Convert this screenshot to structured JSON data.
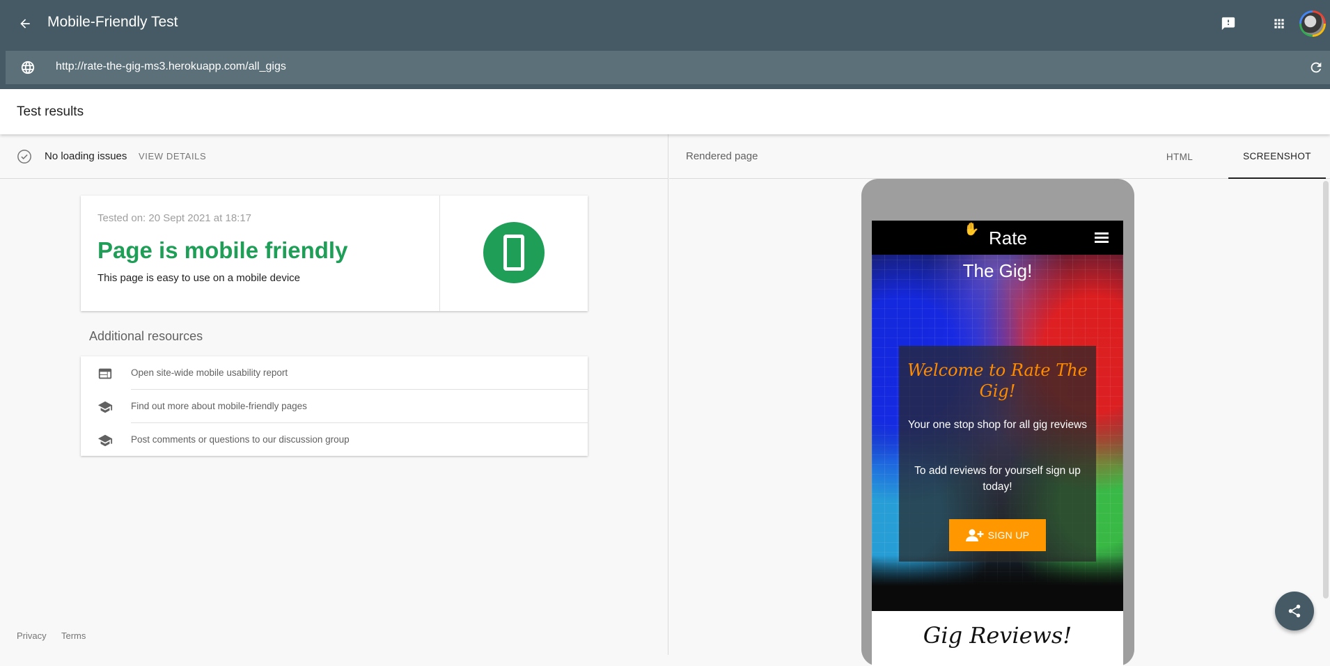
{
  "app": {
    "title": "Mobile-Friendly Test",
    "url": "http://rate-the-gig-ms3.herokuapp.com/all_gigs"
  },
  "results": {
    "title": "Test results"
  },
  "status": {
    "text": "No loading issues",
    "view_details": "VIEW DETAILS"
  },
  "card": {
    "tested_on": "Tested on: 20 Sept 2021 at 18:17",
    "verdict": "Page is mobile friendly",
    "subtitle": "This page is easy to use on a mobile device"
  },
  "resources": {
    "title": "Additional resources",
    "items": [
      {
        "label": "Open site-wide mobile usability report",
        "icon": "web-icon"
      },
      {
        "label": "Find out more about mobile-friendly pages",
        "icon": "school-icon"
      },
      {
        "label": "Post comments or questions to our discussion group",
        "icon": "school-icon"
      }
    ]
  },
  "footer": {
    "privacy": "Privacy",
    "terms": "Terms"
  },
  "rendered": {
    "title": "Rendered page",
    "tabs": [
      "HTML",
      "SCREENSHOT"
    ],
    "selected_tab": "SCREENSHOT"
  },
  "mobile_page": {
    "brand": "Rate",
    "brand_line2": "The Gig!",
    "welcome": "Welcome to Rate The Gig!",
    "p1": "Your one stop shop for all gig reviews",
    "p2": "To add reviews for yourself sign up today!",
    "signup": "SIGN UP",
    "reviews_heading": "Gig Reviews!"
  },
  "colors": {
    "appbar": "#455a64",
    "urlbar": "#5b7079",
    "success": "#1e9e57",
    "signup": "#ff9800",
    "welcome": "#ff8c00"
  }
}
